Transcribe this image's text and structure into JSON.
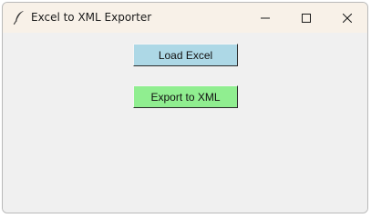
{
  "window": {
    "title": "Excel to XML Exporter",
    "icon": "feather-icon",
    "controls": [
      "minimize-icon",
      "maximize-icon",
      "close-icon"
    ]
  },
  "buttons": {
    "load_excel": {
      "label": "Load Excel",
      "color": "#add8e6"
    },
    "export_xml": {
      "label": "Export to XML",
      "color": "#90ee90"
    }
  }
}
